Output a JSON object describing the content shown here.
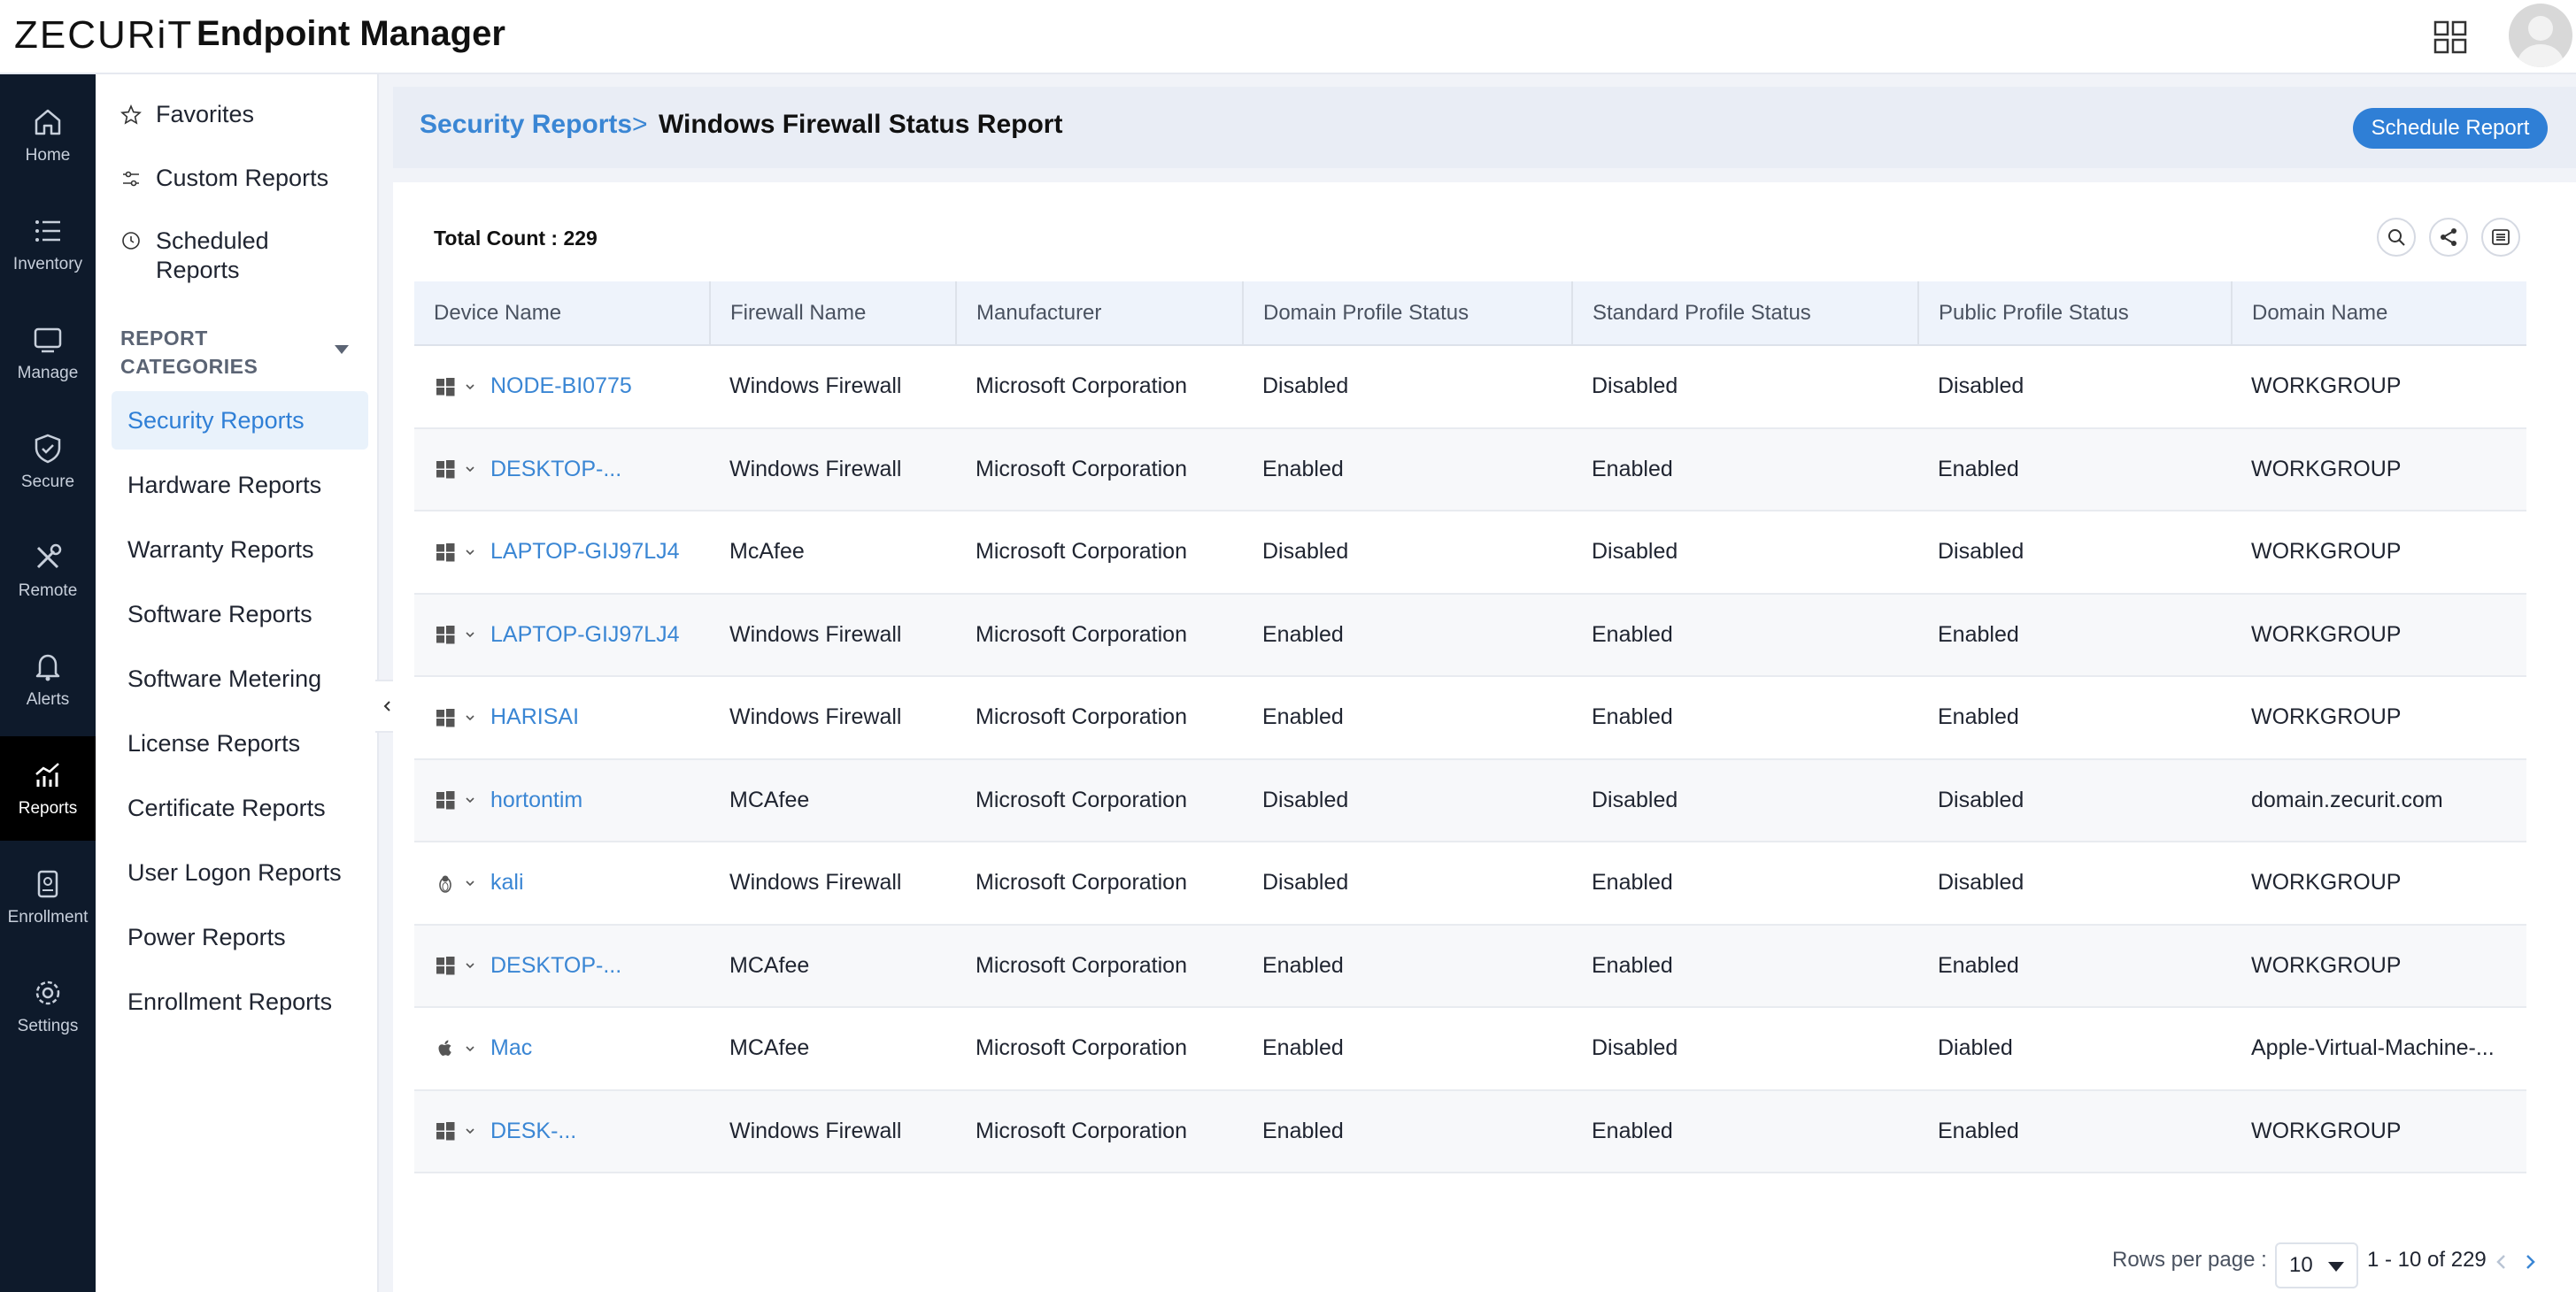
{
  "header": {
    "logo_text": "ZECURiT",
    "app_title": "Endpoint Manager",
    "apps_icon": "grid-icon",
    "avatar_icon": "user-avatar"
  },
  "nav": [
    {
      "label": "Home",
      "icon": "home-icon"
    },
    {
      "label": "Inventory",
      "icon": "list-icon"
    },
    {
      "label": "Manage",
      "icon": "monitor-icon"
    },
    {
      "label": "Secure",
      "icon": "shield-icon"
    },
    {
      "label": "Remote",
      "icon": "tools-icon"
    },
    {
      "label": "Alerts",
      "icon": "bell-icon"
    },
    {
      "label": "Reports",
      "icon": "chart-icon",
      "active": true
    },
    {
      "label": "Enrollment",
      "icon": "document-icon"
    },
    {
      "label": "Settings",
      "icon": "gear-icon"
    }
  ],
  "sidebar": {
    "favorites": "Favorites",
    "custom_reports": "Custom Reports",
    "scheduled_reports": "Scheduled Reports",
    "categories_heading": "REPORT CATEGORIES",
    "categories": [
      "Security Reports",
      "Hardware Reports",
      "Warranty Reports",
      "Software Reports",
      "Software Metering",
      "License Reports",
      "Certificate Reports",
      "User Logon Reports",
      "Power Reports",
      "Enrollment Reports"
    ],
    "active_category": "Security Reports"
  },
  "breadcrumb": {
    "parent": "Security Reports",
    "separator": ">",
    "current": "Windows Firewall Status Report"
  },
  "schedule_button": "Schedule Report",
  "total_count": "Total Count : 229",
  "table": {
    "columns": [
      "Device Name",
      "Firewall Name",
      "Manufacturer",
      "Domain Profile Status",
      "Standard Profile Status",
      "Public Profile Status",
      "Domain Name"
    ],
    "rows": [
      {
        "os": "windows",
        "device": "NODE-BI0775",
        "firewall": "Windows Firewall",
        "manufacturer": "Microsoft Corporation",
        "domain_profile": "Disabled",
        "standard_profile": "Disabled",
        "public_profile": "Disabled",
        "domain": "WORKGROUP"
      },
      {
        "os": "windows",
        "device": "DESKTOP-...",
        "firewall": "Windows Firewall",
        "manufacturer": "Microsoft Corporation",
        "domain_profile": "Enabled",
        "standard_profile": "Enabled",
        "public_profile": "Enabled",
        "domain": "WORKGROUP"
      },
      {
        "os": "windows",
        "device": "LAPTOP-GIJ97LJ4",
        "firewall": "McAfee",
        "manufacturer": "Microsoft Corporation",
        "domain_profile": "Disabled",
        "standard_profile": "Disabled",
        "public_profile": "Disabled",
        "domain": "WORKGROUP"
      },
      {
        "os": "windows",
        "device": "LAPTOP-GIJ97LJ4",
        "firewall": "Windows Firewall",
        "manufacturer": "Microsoft Corporation",
        "domain_profile": "Enabled",
        "standard_profile": "Enabled",
        "public_profile": "Enabled",
        "domain": "WORKGROUP"
      },
      {
        "os": "windows",
        "device": "HARISAI",
        "firewall": "Windows Firewall",
        "manufacturer": "Microsoft Corporation",
        "domain_profile": "Enabled",
        "standard_profile": "Enabled",
        "public_profile": "Enabled",
        "domain": "WORKGROUP"
      },
      {
        "os": "windows",
        "device": "hortontim",
        "firewall": "MCAfee",
        "manufacturer": "Microsoft Corporation",
        "domain_profile": "Disabled",
        "standard_profile": "Disabled",
        "public_profile": "Disabled",
        "domain": "domain.zecurit.com"
      },
      {
        "os": "linux",
        "device": "kali",
        "firewall": "Windows Firewall",
        "manufacturer": "Microsoft Corporation",
        "domain_profile": "Disabled",
        "standard_profile": "Enabled",
        "public_profile": "Disabled",
        "domain": "WORKGROUP"
      },
      {
        "os": "windows",
        "device": "DESKTOP-...",
        "firewall": "MCAfee",
        "manufacturer": "Microsoft Corporation",
        "domain_profile": "Enabled",
        "standard_profile": "Enabled",
        "public_profile": "Enabled",
        "domain": "WORKGROUP"
      },
      {
        "os": "apple",
        "device": "Mac",
        "firewall": "MCAfee",
        "manufacturer": "Microsoft Corporation",
        "domain_profile": "Enabled",
        "standard_profile": "Disabled",
        "public_profile": "Diabled",
        "domain": "Apple-Virtual-Machine-..."
      },
      {
        "os": "windows",
        "device": "DESK-...",
        "firewall": "Windows Firewall",
        "manufacturer": "Microsoft Corporation",
        "domain_profile": "Enabled",
        "standard_profile": "Enabled",
        "public_profile": "Enabled",
        "domain": "WORKGROUP"
      }
    ]
  },
  "pagination": {
    "rows_label": "Rows per page :",
    "rows_value": "10",
    "range": "1 - 10 of 229"
  },
  "colors": {
    "accent": "#2f7fd6",
    "nav_bg": "#0e1a2b",
    "link": "#3a86d4"
  }
}
